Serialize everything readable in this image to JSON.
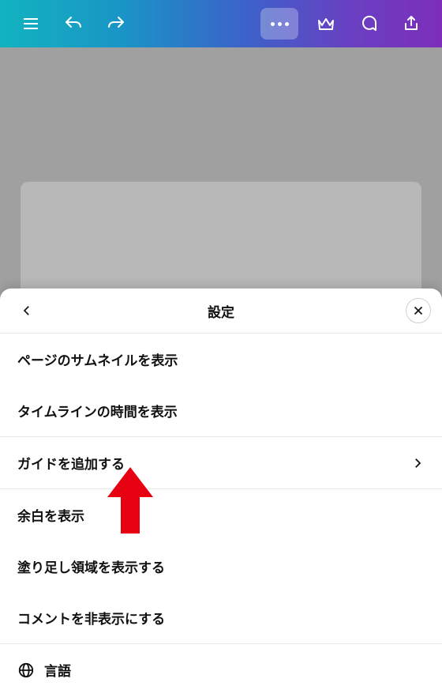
{
  "sheet": {
    "title": "設定",
    "groups": [
      {
        "rows": [
          {
            "label": "ページのサムネイルを表示",
            "chevron": false
          },
          {
            "label": "タイムラインの時間を表示",
            "chevron": false
          }
        ]
      },
      {
        "rows": [
          {
            "label": "ガイドを追加する",
            "chevron": true
          }
        ]
      },
      {
        "rows": [
          {
            "label": "余白を表示",
            "chevron": false
          },
          {
            "label": "塗り足し領域を表示する",
            "chevron": false
          },
          {
            "label": "コメントを非表示にする",
            "chevron": false
          }
        ]
      },
      {
        "rows": [
          {
            "label": "言語",
            "chevron": false,
            "icon": "globe"
          }
        ]
      }
    ]
  }
}
